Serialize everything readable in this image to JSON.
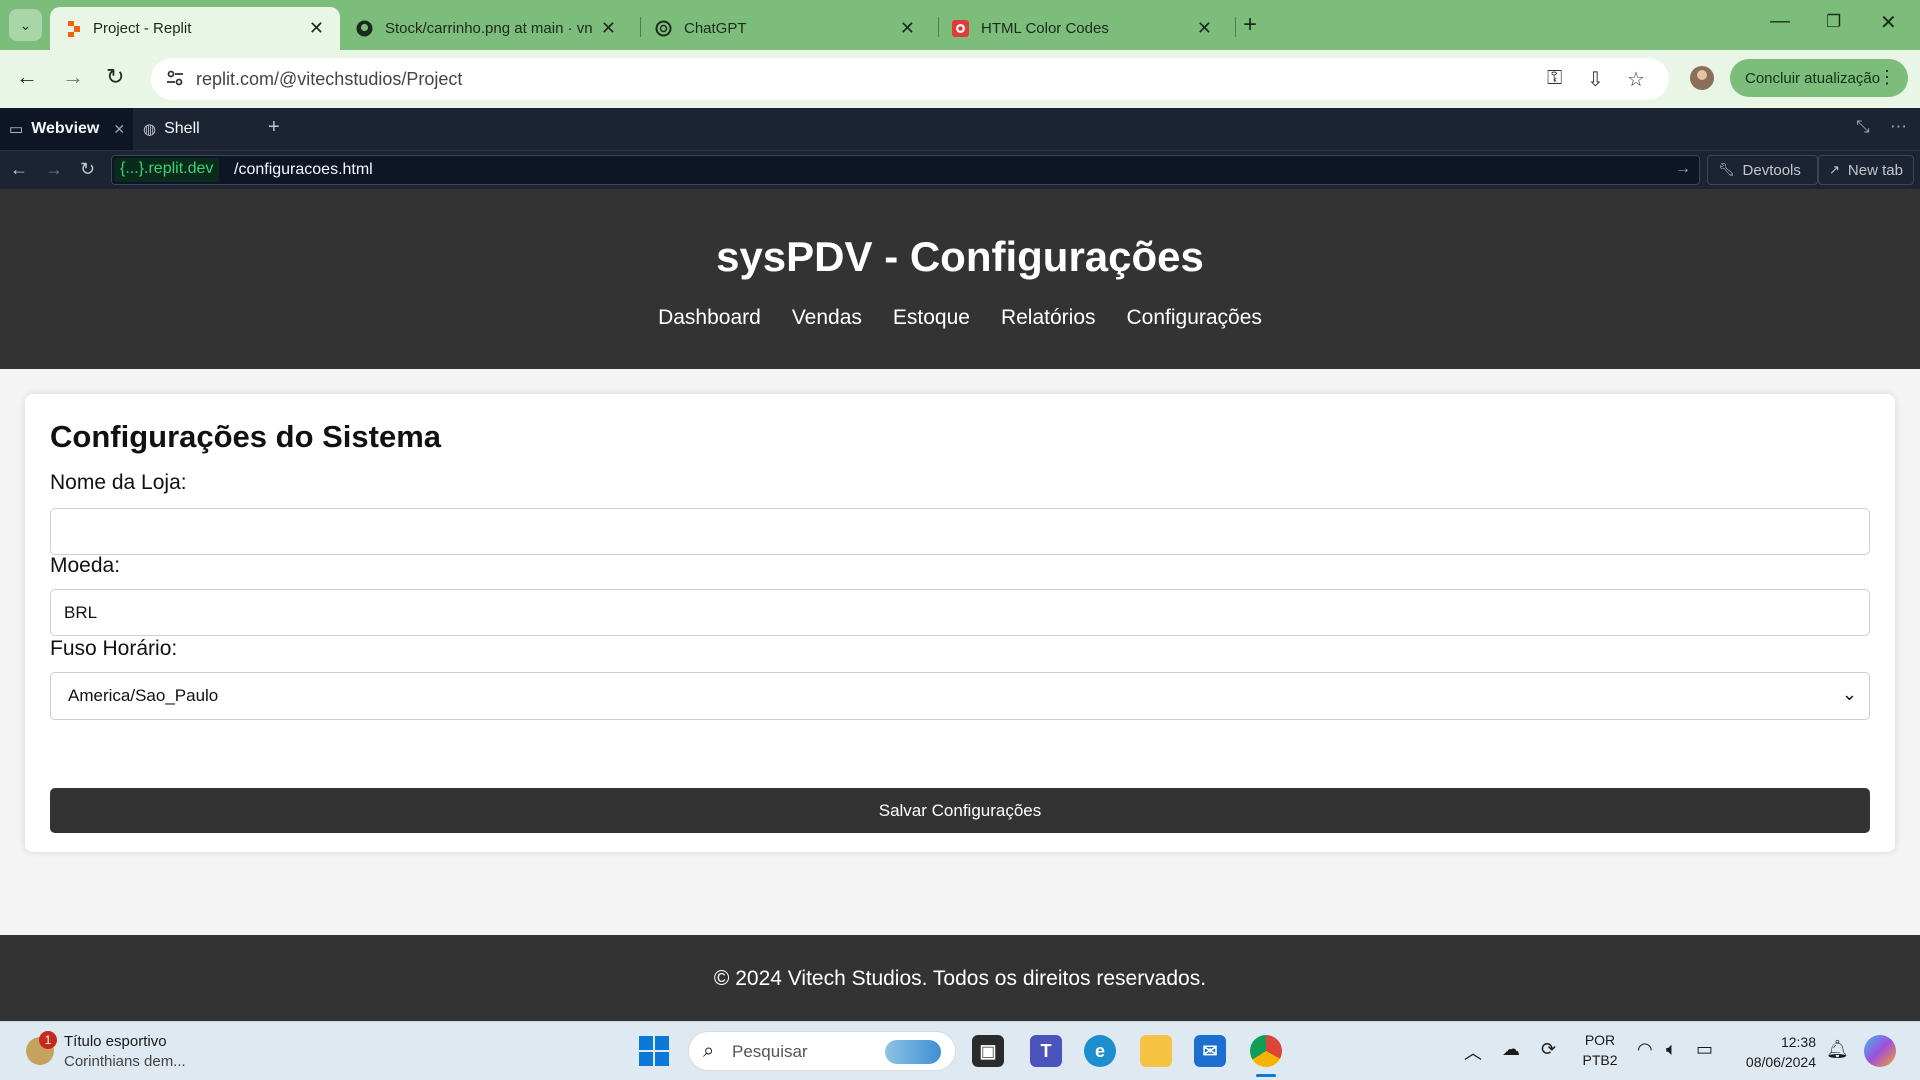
{
  "browser": {
    "tabs": [
      {
        "title": "Project - Replit",
        "active": true
      },
      {
        "title": "Stock/carrinho.png at main · vn",
        "active": false
      },
      {
        "title": "ChatGPT",
        "active": false
      },
      {
        "title": "HTML Color Codes",
        "active": false
      }
    ],
    "address": "replit.com/@vitechstudios/Project",
    "update_label": "Concluir atualização",
    "accent_color": "#7dbd7c"
  },
  "replit": {
    "tabs": [
      {
        "label": "Webview",
        "icon": "monitor-icon"
      },
      {
        "label": "Shell",
        "icon": "shell-icon"
      }
    ],
    "domain": "{...}.replit.dev",
    "path": "/configuracoes.html",
    "devtools_label": "Devtools",
    "newtab_label": "New tab"
  },
  "site": {
    "title": "sysPDV - Configurações",
    "nav": [
      "Dashboard",
      "Vendas",
      "Estoque",
      "Relatórios",
      "Configurações"
    ],
    "section_title": "Configurações do Sistema",
    "fields": {
      "store_name": {
        "label": "Nome da Loja:",
        "value": ""
      },
      "currency": {
        "label": "Moeda:",
        "value": "BRL"
      },
      "timezone": {
        "label": "Fuso Horário:",
        "value": "America/Sao_Paulo"
      }
    },
    "save_label": "Salvar Configurações",
    "footer": "© 2024 Vitech Studios. Todos os direitos reservados.",
    "header_color": "#333333"
  },
  "taskbar": {
    "news_title": "Título esportivo",
    "news_sub": "Corinthians dem...",
    "news_badge": "1",
    "search_placeholder": "Pesquisar",
    "lang_top": "POR",
    "lang_bottom": "PTB2",
    "time": "12:38",
    "date": "08/06/2024"
  }
}
